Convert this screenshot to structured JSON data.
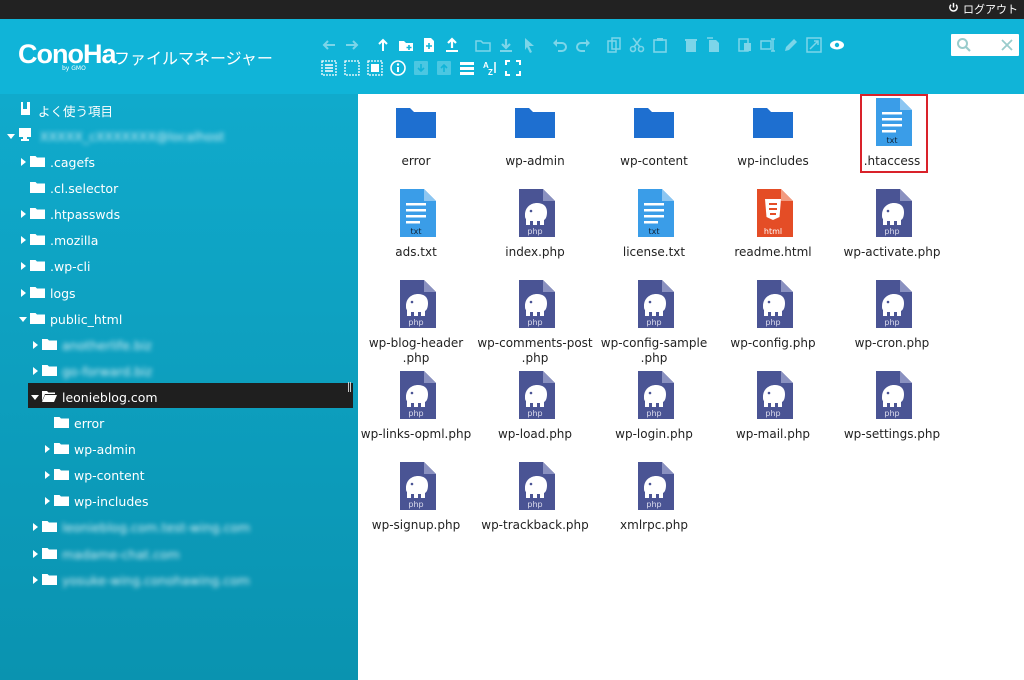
{
  "topbar": {
    "logout_label": "ログアウト"
  },
  "header": {
    "logo": "ConoHa",
    "logo_sub": "by GMO",
    "title": "ファイルマネージャー",
    "search_placeholder": ""
  },
  "toolbar_row1": [
    "arrow-left-icon",
    "arrow-right-icon",
    "arrow-up-icon",
    "new-folder-icon",
    "new-file-icon",
    "upload-icon",
    "open-folder-icon",
    "download-icon",
    "select-icon",
    "undo-icon",
    "redo-icon",
    "copy-icon",
    "cut-icon",
    "paste-icon",
    "delete-icon",
    "duplicate-icon",
    "rename-icon",
    "edit-text-icon",
    "edit-icon",
    "resize-icon",
    "preview-icon"
  ],
  "toolbar_row2": [
    "select-all-icon",
    "select-none-icon",
    "invert-selection-icon",
    "info-icon",
    "extract-icon",
    "archive-icon",
    "view-list-icon",
    "sort-icon",
    "fullscreen-icon"
  ],
  "sidebar": {
    "favorites": "よく使う項目",
    "root": "XXXXX_cXXXXXXX@localhost",
    "items": [
      {
        "label": ".cagefs",
        "depth": 1,
        "expander": "collapsed"
      },
      {
        "label": ".cl.selector",
        "depth": 1,
        "expander": "none"
      },
      {
        "label": ".htpasswds",
        "depth": 1,
        "expander": "collapsed"
      },
      {
        "label": ".mozilla",
        "depth": 1,
        "expander": "collapsed"
      },
      {
        "label": ".wp-cli",
        "depth": 1,
        "expander": "collapsed"
      },
      {
        "label": "logs",
        "depth": 1,
        "expander": "collapsed"
      },
      {
        "label": "public_html",
        "depth": 1,
        "expander": "expanded"
      },
      {
        "label": "anotherlife.biz",
        "depth": 2,
        "expander": "collapsed",
        "blurred": true
      },
      {
        "label": "go-forward.biz",
        "depth": 2,
        "expander": "collapsed",
        "blurred": true
      },
      {
        "label": "leonieblog.com",
        "depth": 2,
        "expander": "expanded",
        "selected": true
      },
      {
        "label": "error",
        "depth": 3,
        "expander": "none"
      },
      {
        "label": "wp-admin",
        "depth": 3,
        "expander": "collapsed"
      },
      {
        "label": "wp-content",
        "depth": 3,
        "expander": "collapsed"
      },
      {
        "label": "wp-includes",
        "depth": 3,
        "expander": "collapsed"
      },
      {
        "label": "leonieblog.com.test-wing.com",
        "depth": 2,
        "expander": "collapsed",
        "blurred": true
      },
      {
        "label": "madame-chat.com",
        "depth": 2,
        "expander": "collapsed",
        "blurred": true
      },
      {
        "label": "yosuke-wing.conohawing.com",
        "depth": 2,
        "expander": "collapsed",
        "blurred": true
      }
    ]
  },
  "files": [
    {
      "name": "error",
      "type": "folder"
    },
    {
      "name": "wp-admin",
      "type": "folder"
    },
    {
      "name": "wp-content",
      "type": "folder"
    },
    {
      "name": "wp-includes",
      "type": "folder"
    },
    {
      "name": ".htaccess",
      "type": "txt",
      "tag": "txt",
      "highlighted": true
    },
    {
      "name": "ads.txt",
      "type": "txt",
      "tag": "txt"
    },
    {
      "name": "index.php",
      "type": "php",
      "tag": "php"
    },
    {
      "name": "license.txt",
      "type": "txt",
      "tag": "txt"
    },
    {
      "name": "readme.html",
      "type": "html",
      "tag": "html"
    },
    {
      "name": "wp-activate.php",
      "type": "php",
      "tag": "php"
    },
    {
      "name": "wp-blog-header\n.php",
      "type": "php",
      "tag": "php"
    },
    {
      "name": "wp-comments-post\n.php",
      "type": "php",
      "tag": "php"
    },
    {
      "name": "wp-config-sample\n.php",
      "type": "php",
      "tag": "php"
    },
    {
      "name": "wp-config.php",
      "type": "php",
      "tag": "php"
    },
    {
      "name": "wp-cron.php",
      "type": "php",
      "tag": "php"
    },
    {
      "name": "wp-links-opml.php",
      "type": "php",
      "tag": "php"
    },
    {
      "name": "wp-load.php",
      "type": "php",
      "tag": "php"
    },
    {
      "name": "wp-login.php",
      "type": "php",
      "tag": "php"
    },
    {
      "name": "wp-mail.php",
      "type": "php",
      "tag": "php"
    },
    {
      "name": "wp-settings.php",
      "type": "php",
      "tag": "php"
    },
    {
      "name": "wp-signup.php",
      "type": "php",
      "tag": "php"
    },
    {
      "name": "wp-trackback.php",
      "type": "php",
      "tag": "php"
    },
    {
      "name": "xmlrpc.php",
      "type": "php",
      "tag": "php"
    }
  ],
  "colors": {
    "header": "#10b4d8",
    "sidebar": "#0fa5c6",
    "folder": "#1e6fd0",
    "txt": "#3a9de8",
    "php": "#4a5494",
    "html": "#e44d26",
    "highlight": "#d9222a"
  }
}
